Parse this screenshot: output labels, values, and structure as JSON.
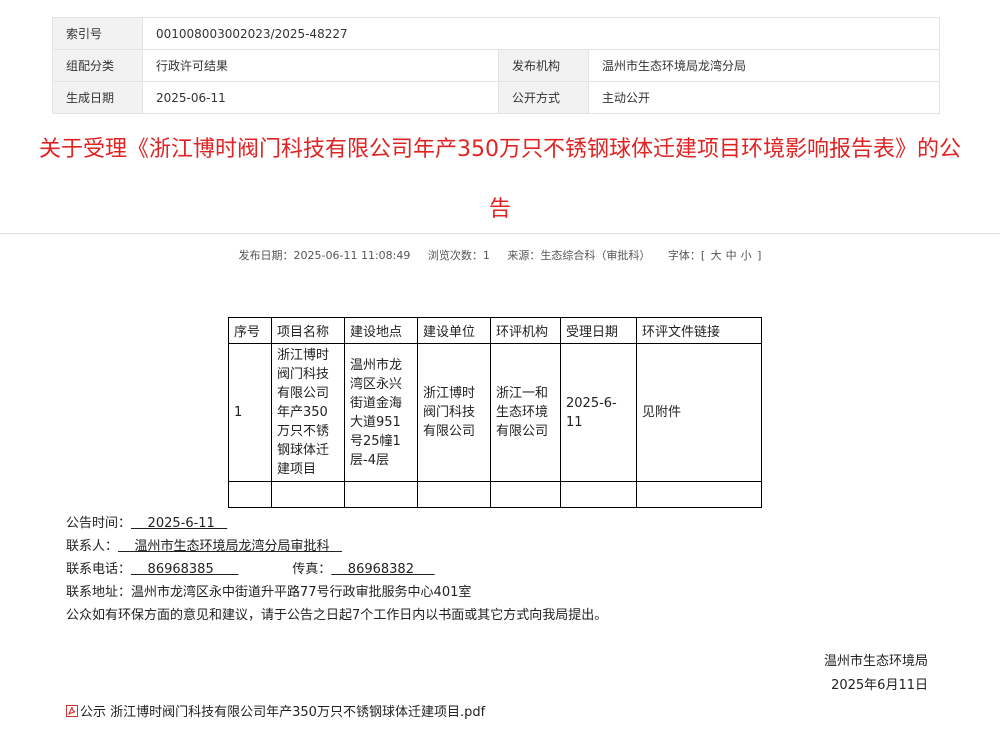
{
  "meta": {
    "index_label": "索引号",
    "index_value": "001008003002023/2025-48227",
    "category_label": "组配分类",
    "category_value": "行政许可结果",
    "publisher_label": "发布机构",
    "publisher_value": "温州市生态环境局龙湾分局",
    "date_label": "生成日期",
    "date_value": "2025-06-11",
    "mode_label": "公开方式",
    "mode_value": "主动公开"
  },
  "title_line1": "关于受理《浙江博时阀门科技有限公司年产350万只不锈钢球体迁建项目环境影响报告表》的公",
  "title_line2": "告",
  "info": {
    "publish_date": "发布日期：2025-06-11 11:08:49",
    "views": "浏览次数：1",
    "source": "来源：生态综合科（审批科）",
    "font_label": "字体：[",
    "font_large": "大",
    "font_medium": "中",
    "font_small": "小",
    "font_end": "]"
  },
  "table": {
    "headers": [
      "序号",
      "项目名称",
      "建设地点",
      "建设单位",
      "环评机构",
      "受理日期",
      "环评文件链接"
    ],
    "row": {
      "no": "1",
      "name": "浙江博时阀门科技有限公司年产350万只不锈钢球体迁建项目",
      "location": "温州市龙湾区永兴街道金海大道951号25幢1层-4层",
      "unit": "浙江博时阀门科技有限公司",
      "agency": "浙江一和生态环境有限公司",
      "date": "2025-6-11",
      "link": "见附件"
    }
  },
  "notice": {
    "time_label": "公告时间：",
    "time_value": "    2025-6-11   ",
    "contact_label": "联系人：",
    "contact_value": "    温州市生态环境局龙湾分局审批科   ",
    "phone_label": "联系电话：",
    "phone_value": "    86968385      ",
    "fax_label": "传真：",
    "fax_value": "    86968382     ",
    "address": "联系地址：温州市龙湾区永中街道升平路77号行政审批服务中心401室",
    "advice": "公众如有环保方面的意见和建议，请于公告之日起7个工作日内以书面或其它方式向我局提出。"
  },
  "sign": {
    "org": "温州市生态环境局",
    "date": "2025年6月11日"
  },
  "attachment": {
    "icon": "pdf-icon",
    "label": "公示 浙江博时阀门科技有限公司年产350万只不锈钢球体迁建项目.pdf"
  }
}
